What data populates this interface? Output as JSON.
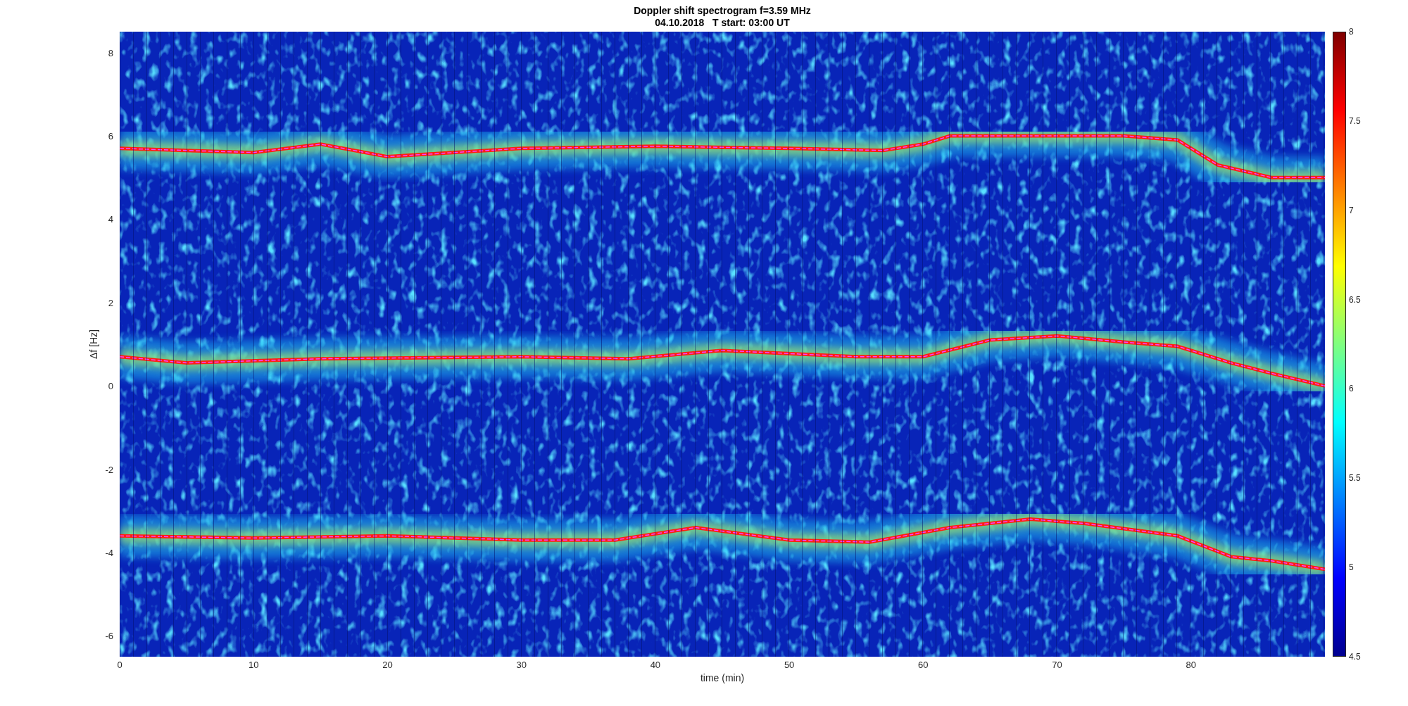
{
  "figure": {
    "title": [
      "Doppler shift spectrogram f=3.59 MHz",
      "04.10.2018   T start: 03:00 UT"
    ],
    "axes": {
      "xlabel": "time (min)",
      "ylabel": "Δf [Hz]",
      "xticks": [
        "0",
        "10",
        "20",
        "30",
        "40",
        "50",
        "60",
        "70",
        "80"
      ],
      "yticks": [
        "8",
        "6",
        "4",
        "2",
        "0",
        "-2",
        "-4",
        "-6"
      ]
    },
    "colorbar": {
      "ticks": [
        "8",
        "7.5",
        "7",
        "6.5",
        "6",
        "5.5",
        "5",
        "4.5"
      ]
    }
  }
}
